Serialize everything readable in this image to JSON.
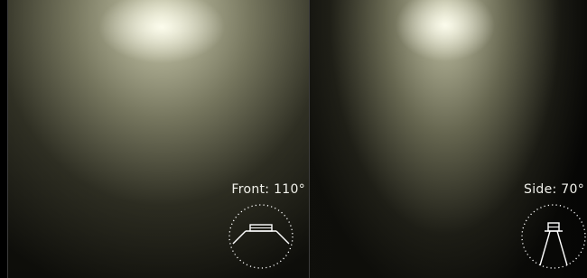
{
  "panels": [
    {
      "id": "front",
      "label": "Front: 110°",
      "icon": "wide-beam-angle-icon"
    },
    {
      "id": "side",
      "label": "Side: 70°",
      "icon": "narrow-beam-angle-icon"
    }
  ],
  "colors": {
    "background": "#000000",
    "label": "#f0f0ea",
    "divider": "#3c3c3c",
    "beam": "#e8e8cc"
  }
}
